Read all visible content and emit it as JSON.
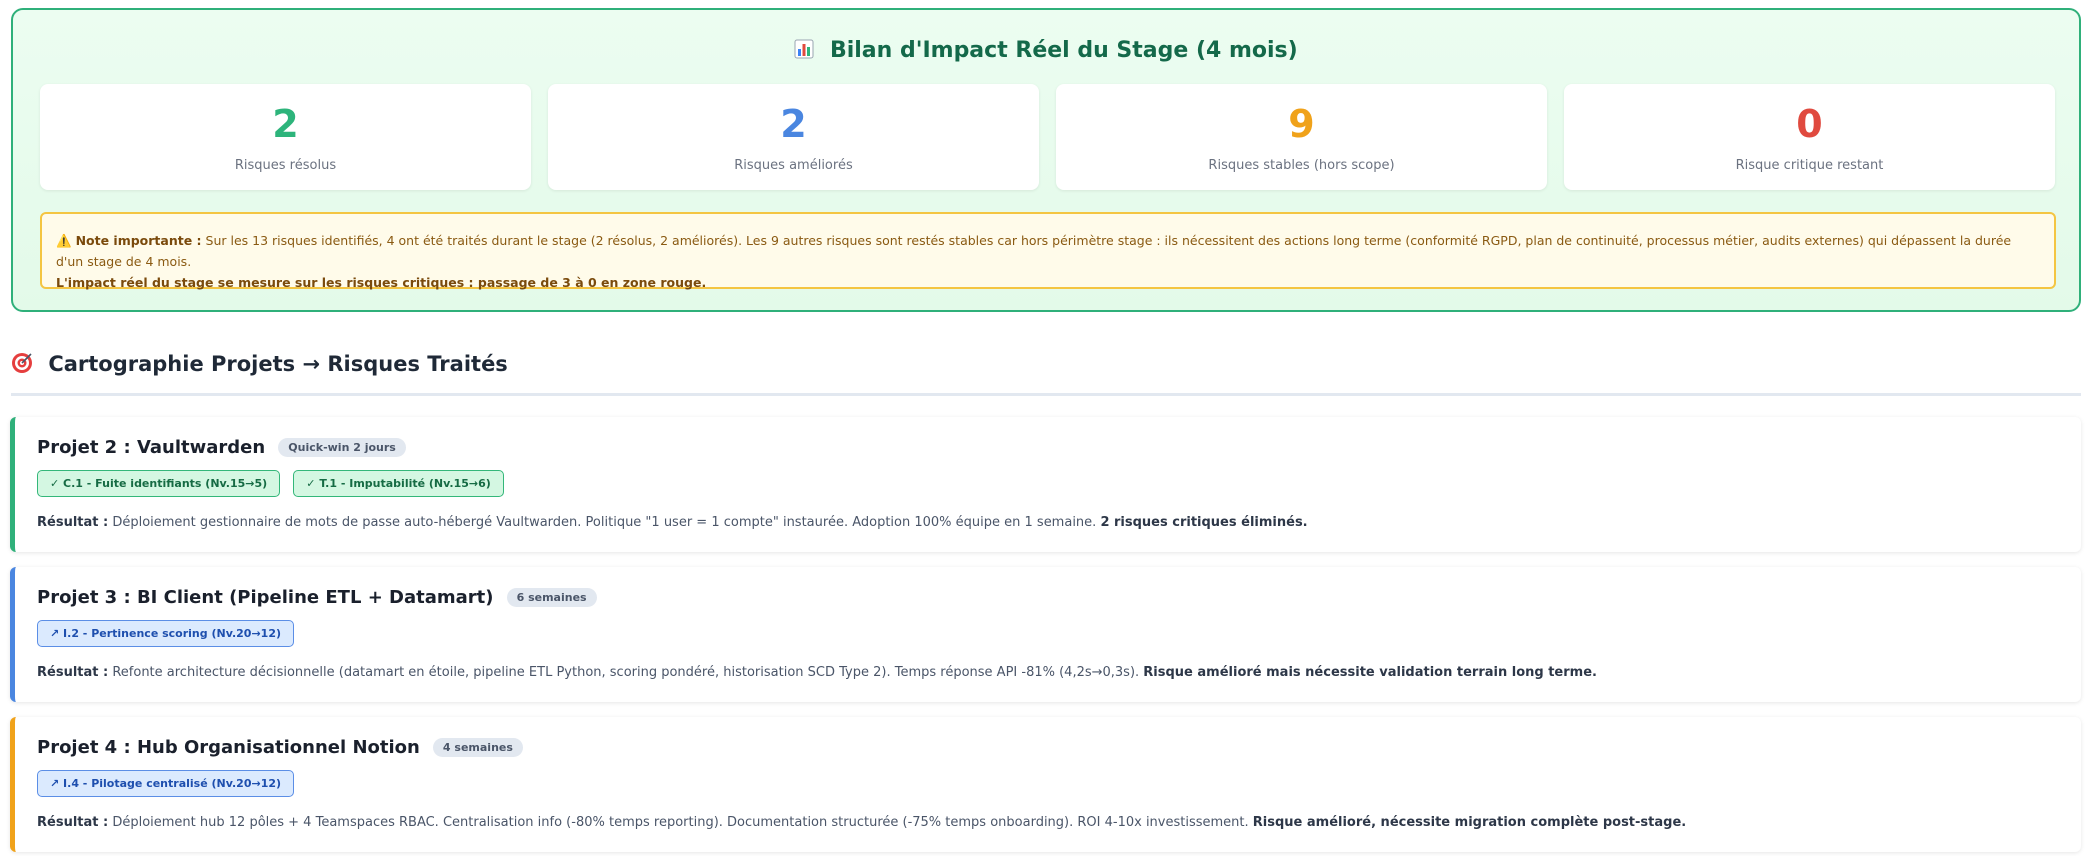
{
  "impact": {
    "icon": "bar-chart-icon",
    "title": "Bilan d'Impact Réel du Stage (4 mois)",
    "stats": [
      {
        "value": "2",
        "label": "Risques résolus",
        "color": "#2db47b"
      },
      {
        "value": "2",
        "label": "Risques améliorés",
        "color": "#4a86e0"
      },
      {
        "value": "9",
        "label": "Risques stables (hors scope)",
        "color": "#f0a21a"
      },
      {
        "value": "0",
        "label": "Risque critique restant",
        "color": "#e04a3f"
      }
    ],
    "note": {
      "icon": "warning-icon",
      "label": "Note importante :",
      "text": " Sur les 13 risques identifiés, 4 ont été traités durant le stage (2 résolus, 2 améliorés). Les 9 autres risques sont restés stables car hors périmètre stage : ils nécessitent des actions long terme (conformité RGPD, plan de continuité, processus métier, audits externes) qui dépassent la durée d'un stage de 4 mois.",
      "conclusion": "L'impact réel du stage se mesure sur les risques critiques : passage de 3 à 0 en zone rouge."
    }
  },
  "section": {
    "icon": "target-icon",
    "title": "Cartographie Projets → Risques Traités"
  },
  "projects": [
    {
      "title": "Projet 2 : Vaultwarden",
      "badge": "Quick-win 2 jours",
      "accent": "#2fb07a",
      "tags": [
        {
          "text": "✓ C.1 - Fuite identifiants (Nv.15→5)",
          "kind": "ok"
        },
        {
          "text": "✓ T.1 - Imputabilité (Nv.15→6)",
          "kind": "ok"
        }
      ],
      "result_label": "Résultat :",
      "result_text": " Déploiement gestionnaire de mots de passe auto-hébergé Vaultwarden. Politique \"1 user = 1 compte\" instaurée. Adoption 100% équipe en 1 semaine. ",
      "result_bold": "2 risques critiques éliminés."
    },
    {
      "title": "Projet 3 : BI Client (Pipeline ETL + Datamart)",
      "badge": "6 semaines",
      "accent": "#4a86e0",
      "tags": [
        {
          "text": "↗ I.2 - Pertinence scoring (Nv.20→12)",
          "kind": "up"
        }
      ],
      "result_label": "Résultat :",
      "result_text": " Refonte architecture décisionnelle (datamart en étoile, pipeline ETL Python, scoring pondéré, historisation SCD Type 2). Temps réponse API -81% (4,2s→0,3s). ",
      "result_bold": "Risque amélioré mais nécessite validation terrain long terme."
    },
    {
      "title": "Projet 4 : Hub Organisationnel Notion",
      "badge": "4 semaines",
      "accent": "#f0a21a",
      "tags": [
        {
          "text": "↗ I.4 - Pilotage centralisé (Nv.20→12)",
          "kind": "up"
        }
      ],
      "result_label": "Résultat :",
      "result_text": " Déploiement hub 12 pôles + 4 Teamspaces RBAC. Centralisation info (-80% temps reporting). Documentation structurée (-75% temps onboarding). ROI 4-10x investissement. ",
      "result_bold": "Risque amélioré, nécessite migration complète post-stage."
    }
  ]
}
